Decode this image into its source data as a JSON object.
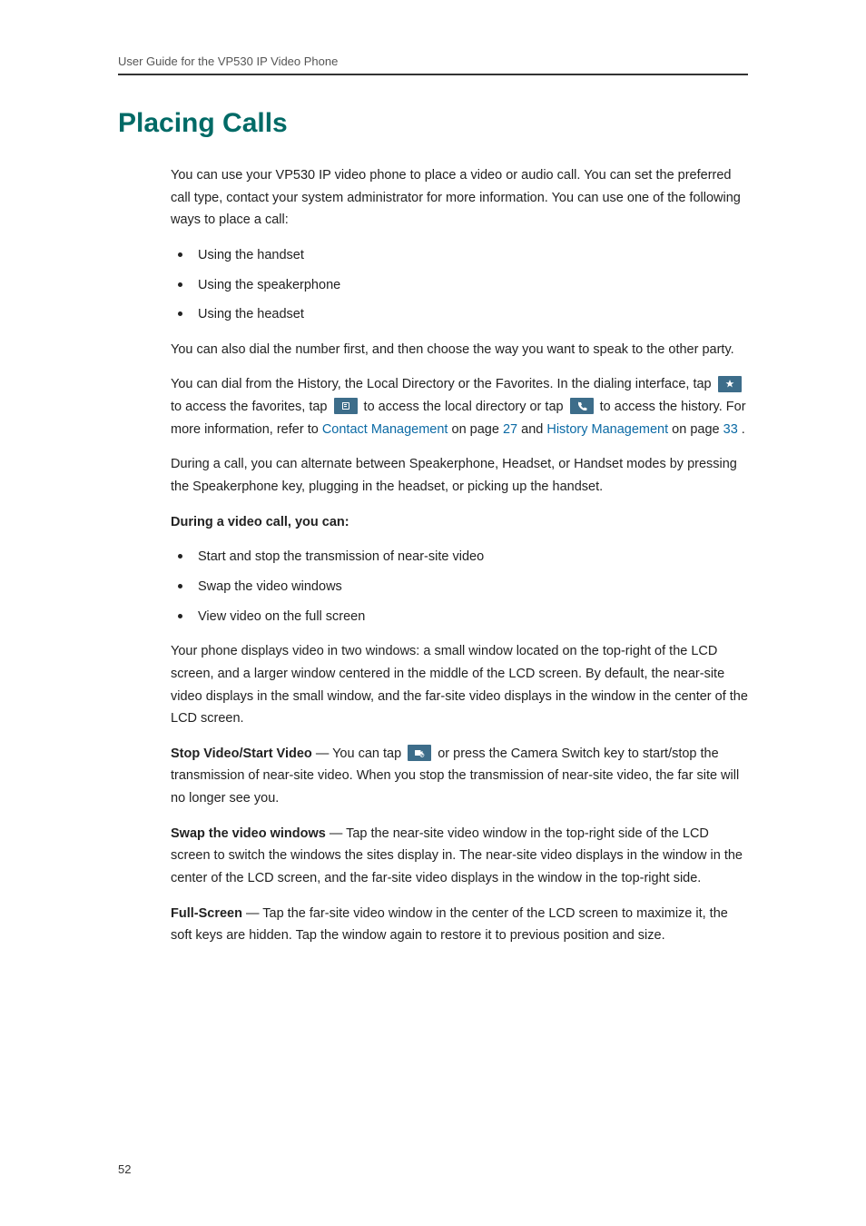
{
  "header": {
    "running": "User Guide for the VP530 IP Video Phone"
  },
  "title": "Placing Calls",
  "intro": "You can use your VP530 IP video phone to place a video or audio call. You can set the preferred call type, contact your system administrator for more information. You can use one of the following ways to place a call:",
  "ways": [
    "Using the handset",
    "Using the speakerphone",
    "Using the headset"
  ],
  "also_dial": "You can also dial the number first, and then choose the way you want to speak to the other party.",
  "dial_from": {
    "lead": "You can dial from the History, the Local Directory or the Favorites. In the dialing interface, tap ",
    "fav": " to access the favorites, tap ",
    "dir": " to access the local directory or tap ",
    "hist_lead": " to access the history. For more information, refer to ",
    "link_cm": "Contact Management",
    "cm_tail": " on page ",
    "cm_page": "27",
    "and": " and ",
    "link_hm": "History Management",
    "hm_tail": " on page ",
    "hm_page": "33",
    "period": "."
  },
  "during_modes": "During a call, you can alternate between Speakerphone, Headset, or Handset modes by pressing the Speakerphone key, plugging in the headset, or picking up the handset.",
  "video_heading": "During a video call, you can:",
  "video_list": [
    "Start and stop the transmission of near-site video",
    "Swap the video windows",
    "View video on the full screen"
  ],
  "windows_desc": "Your phone displays video in two windows: a small window located on the top-right of the LCD screen, and a larger window centered in the middle of the LCD screen. By default, the near-site video displays in the small window, and the far-site video displays in the window in the center of the LCD screen.",
  "stop_video": {
    "label": "Stop Video/Start Video",
    "dash": " — You can tap ",
    "tail": " or press the Camera Switch key to start/stop the transmission of near-site video. When you stop the transmission of near-site video, the far site will no longer see you."
  },
  "swap": {
    "label": "Swap the video windows",
    "dash": " — Tap the near-site video window in the top-right side of the LCD screen to switch the windows the sites display in. The near-site video displays in the window in the center of the LCD screen, and the far-site video displays in the window in the top-right side."
  },
  "full": {
    "label": "Full-Screen",
    "dash": " — Tap the far-site video window in the center of the LCD screen to maximize it, the soft keys are hidden. Tap the window again to restore it to previous position and size."
  },
  "page_number": "52"
}
